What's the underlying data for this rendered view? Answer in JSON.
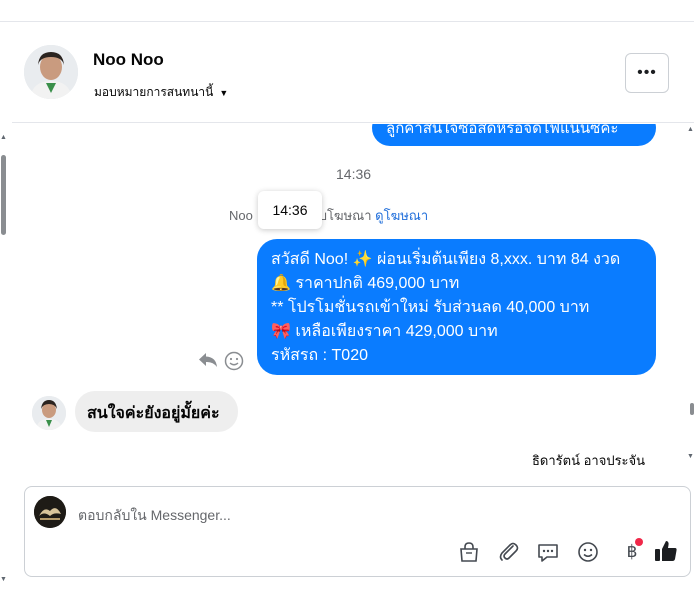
{
  "header": {
    "name": "Noo Noo",
    "assign_label": "มอบหมายการสนทนานี้",
    "more_label": "•••"
  },
  "messages": {
    "cut_bubble_text": "ลูกค้าสนใจซื้อสดหรือจัดไฟแนนซ์คะ",
    "time_divider": "14:36",
    "ad_prefix": "Noo",
    "ad_middle": "กลับโฆษณา",
    "ad_link": "ดูโฆษณา",
    "tooltip_time": "14:36",
    "outgoing": {
      "line1": "สวัสดี Noo! ✨  ผ่อนเริ่มต้นเพียง 8,xxx. บาท 84 งวด",
      "line2": "🔔 ราคาปกติ 469,000 บาท",
      "line3": "** โปรโมชั่นรถเข้าใหม่ รับส่วนลด 40,000 บาท",
      "line4": "🎀  เหลือเพียงราคา 429,000 บาท",
      "line5": " รหัสรถ : T020"
    },
    "incoming_text": "สนใจค่ะยังอยู่มั้ยค่ะ",
    "agent_name": "ธิดารัตน์ อาจประจัน"
  },
  "composer": {
    "placeholder": "ตอบกลับใน Messenger..."
  },
  "colors": {
    "messenger_blue": "#0a7cff",
    "link_blue": "#216fdb",
    "notification_red": "#f02849",
    "incoming_bubble": "#eeeeee"
  },
  "icons": {
    "header": [
      "more-options-icon",
      "chevron-down-icon"
    ],
    "message": [
      "reply-icon",
      "react-smiley-icon"
    ],
    "composer": [
      "shopping-bag-icon",
      "paperclip-icon",
      "chat-bubble-icon",
      "emoji-icon",
      "baht-icon",
      "thumbs-up-icon"
    ]
  }
}
